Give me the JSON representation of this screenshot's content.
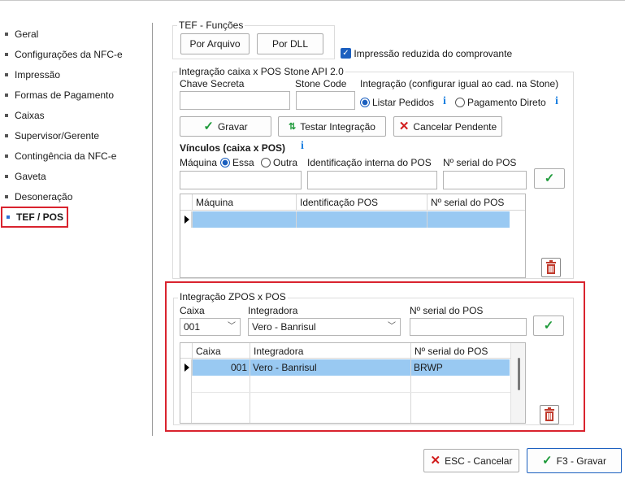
{
  "sidebar": {
    "items": [
      {
        "label": "Geral"
      },
      {
        "label": "Configurações da NFC-e"
      },
      {
        "label": "Impressão"
      },
      {
        "label": "Formas de Pagamento"
      },
      {
        "label": "Caixas"
      },
      {
        "label": "Supervisor/Gerente"
      },
      {
        "label": "Contingência da NFC-e"
      },
      {
        "label": "Gaveta"
      },
      {
        "label": "Desoneração"
      },
      {
        "label": "TEF / POS"
      }
    ],
    "active": "TEF / POS"
  },
  "tef_funcoes": {
    "title": "TEF - Funções",
    "por_arquivo_label": "Por Arquivo",
    "por_dll_label": "Por DLL",
    "impressao_reduzida_label": "Impressão reduzida do comprovante",
    "impressao_reduzida_checked": true
  },
  "stone": {
    "title": "Integração caixa x POS Stone API 2.0",
    "chave_secreta_label": "Chave Secreta",
    "chave_secreta_value": "",
    "stone_code_label": "Stone Code",
    "stone_code_value": "",
    "integracao_label": "Integração (configurar igual ao cad. na Stone)",
    "listar_pedidos_label": "Listar Pedidos",
    "pagamento_direto_label": "Pagamento Direto",
    "integracao_selected": "Listar Pedidos",
    "gravar_label": "Gravar",
    "testar_label": "Testar Integração",
    "cancelar_label": "Cancelar Pendente",
    "vinculos_title": "Vínculos (caixa x POS)",
    "maquina_label": "Máquina",
    "essa_label": "Essa",
    "outra_label": "Outra",
    "maquina_selected": "Essa",
    "identificacao_label": "Identificação interna do POS",
    "serial_label": "Nº serial do POS",
    "maquina_value": "",
    "identificacao_value": "",
    "serial_value": "",
    "grid": {
      "columns": [
        "Máquina",
        "Identificação POS",
        "Nº serial do POS"
      ],
      "rows": [
        [
          "",
          "",
          ""
        ]
      ]
    }
  },
  "zpos": {
    "title": "Integração ZPOS x POS",
    "caixa_label": "Caixa",
    "caixa_value": "001",
    "integradora_label": "Integradora",
    "integradora_value": "Vero - Banrisul",
    "serial_label": "Nº serial do POS",
    "serial_value": "",
    "grid": {
      "columns": [
        "Caixa",
        "Integradora",
        "Nº serial do POS"
      ],
      "rows": [
        [
          "001",
          "Vero - Banrisul",
          "BRWP"
        ]
      ]
    }
  },
  "footer": {
    "cancelar_label": "ESC - Cancelar",
    "gravar_label": "F3 - Gravar"
  },
  "colors": {
    "accent": "#1b5fbf",
    "highlight_border": "#d9232e",
    "selected_row": "#99c9f2"
  }
}
